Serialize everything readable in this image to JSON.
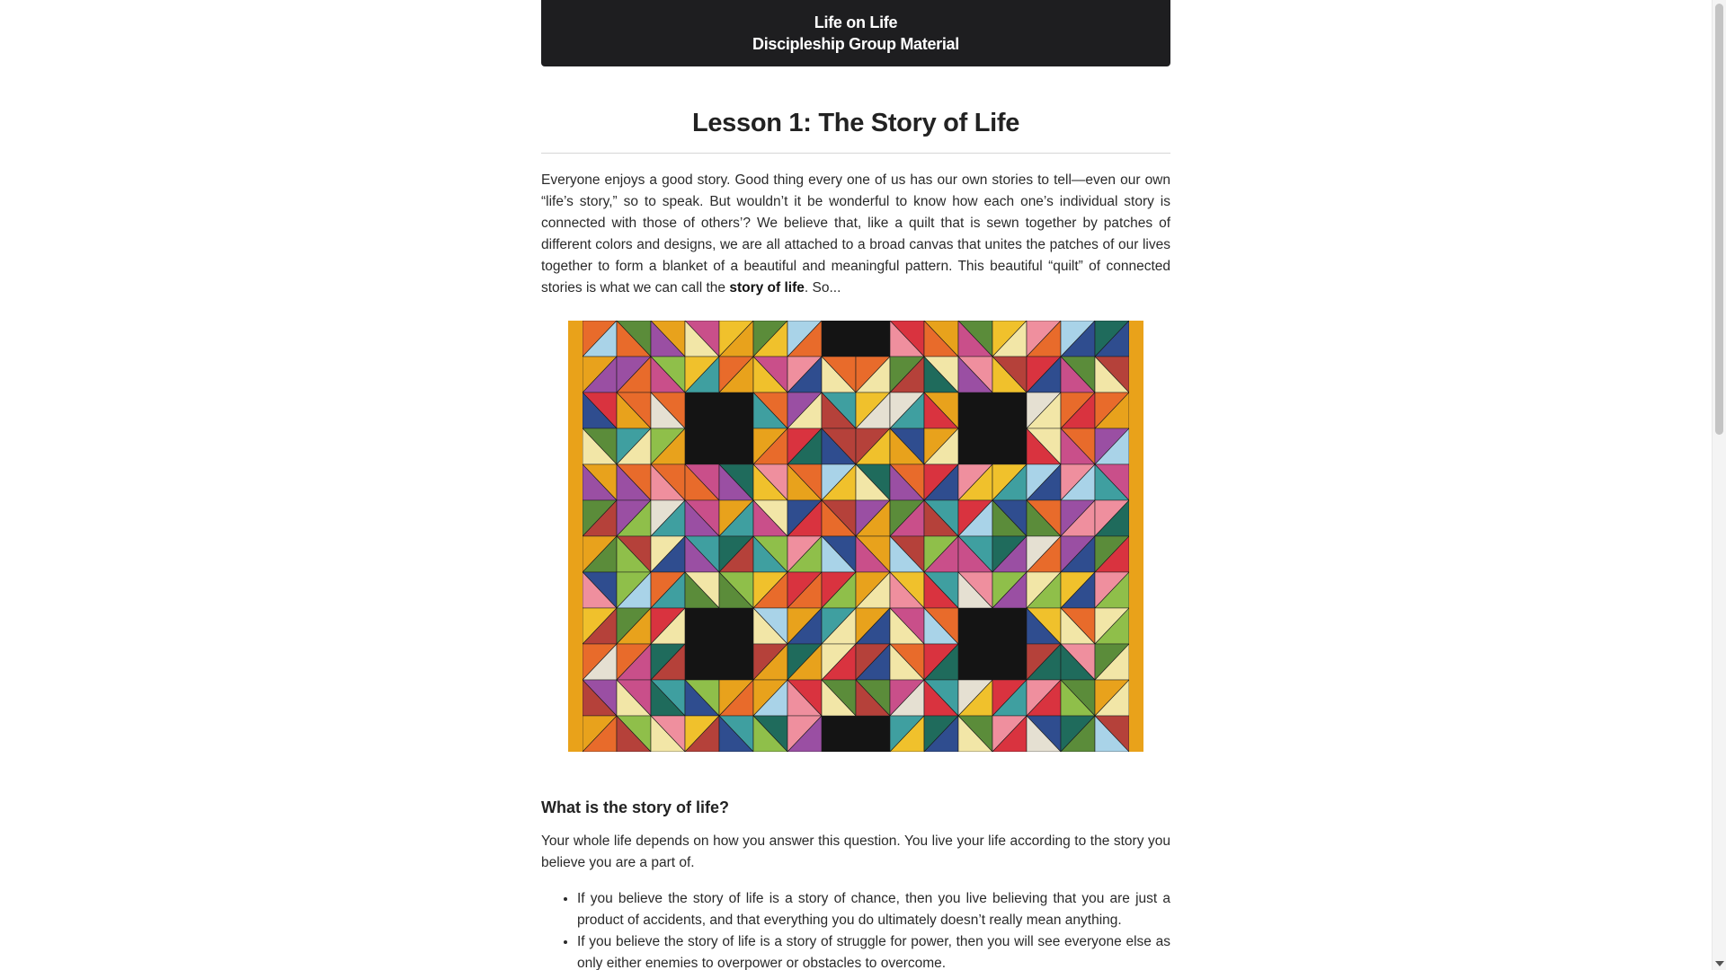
{
  "header": {
    "line1": "Life on Life",
    "line2": "Discipleship Group Material"
  },
  "lesson": {
    "title": "Lesson 1: The Story of Life",
    "intro_before_bold": "Everyone enjoys a good story. Good thing every one of us has our own stories to tell—even our own “life’s story,” so to speak. But wouldn’t it be wonderful to know how each one’s individual story is connected with those of others’? We believe that, like a quilt that is sewn together by patches of different colors and designs, we are all attached to a broad canvas that unites the patches of our lives together to form a blanket of a beautiful and meaningful pattern. This beautiful “quilt” of connected stories is what we can call the ",
    "intro_bold": "story of life",
    "intro_after_bold": ". So..."
  },
  "image": {
    "icon": "patchwork-quilt-image",
    "colors": [
      "#d9333f",
      "#e8a21c",
      "#3f9fa0",
      "#5b8c3a",
      "#f2e6a7",
      "#2f4d8f",
      "#c94f8a",
      "#e86b2b",
      "#a9d3e8",
      "#8fbf4a",
      "#f0c12c",
      "#b5413a",
      "#1f6b5c",
      "#e5e0d2",
      "#9a4fa3",
      "#ef8f9e"
    ]
  },
  "section": {
    "heading": "What is the story of life?",
    "paragraph": "Your whole life depends on how you answer this question. You live your life according to the story you believe you are a part of.",
    "bullets": [
      "If you believe the story of life is a story of chance, then you live believing that you are just a product of accidents, and that everything you do ultimately doesn’t really mean anything.",
      "If you believe the story of life is a story of struggle for power, then you will see everyone else as only either enemies to overpower or obstacles to overcome."
    ]
  },
  "scrollbar": {
    "position_fraction": 0.0,
    "visible_fraction": 0.45
  }
}
